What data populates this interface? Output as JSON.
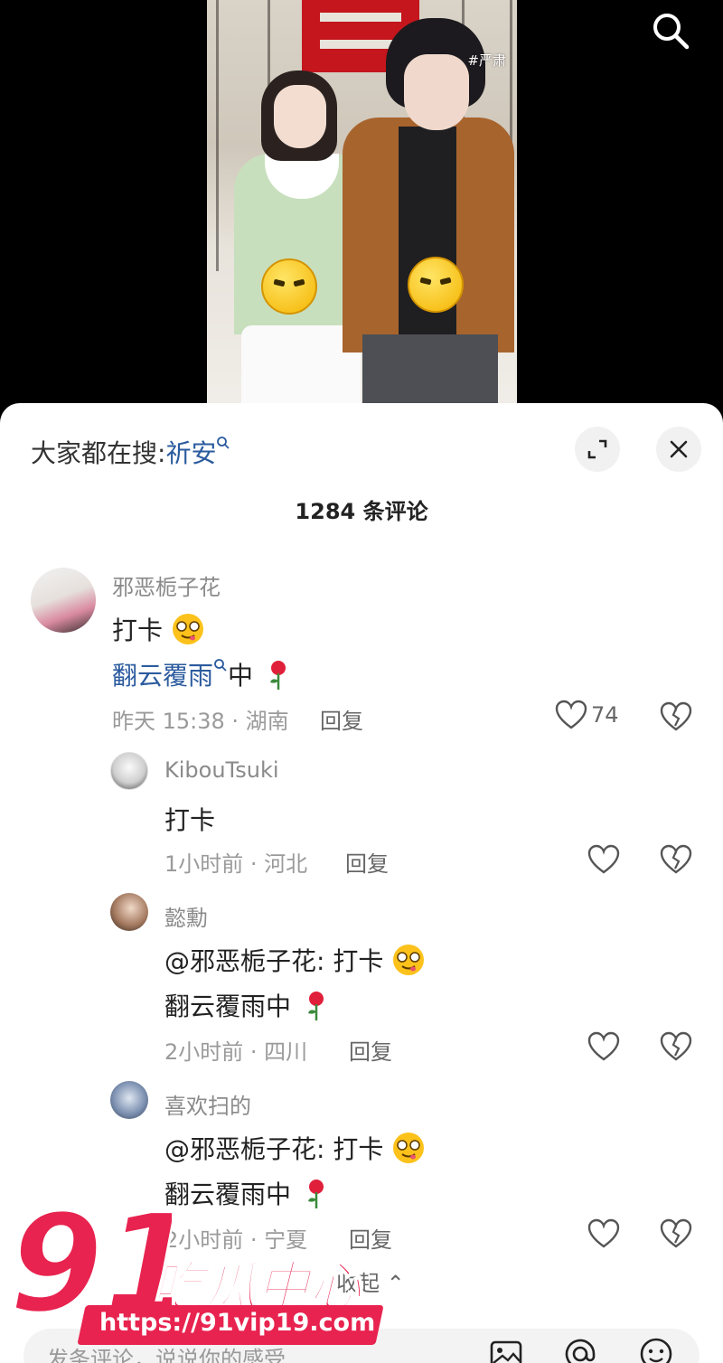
{
  "video": {
    "hashtag": "#严肃"
  },
  "sheet": {
    "search_prefix": "大家都在搜:",
    "search_keyword": "祈安",
    "comment_count": "1284 条评论"
  },
  "comments": [
    {
      "username": "邪恶栀子花",
      "line1": "打卡",
      "line2_link": "翻云覆雨",
      "line2_suffix": "中",
      "time": "昨天 15:38 · 湖南",
      "reply": "回复",
      "likes": "74"
    },
    {
      "username": "KibouTsuki",
      "line1": "打卡",
      "time": "1小时前 · 河北",
      "reply": "回复"
    },
    {
      "username": "懿勳",
      "line1": "@邪恶栀子花: 打卡",
      "line2": "翻云覆雨中",
      "time": "2小时前 · 四川",
      "reply": "回复"
    },
    {
      "username": "喜欢扫的",
      "line1": "@邪恶栀子花: 打卡",
      "line2": "翻云覆雨中",
      "time": "2小时前 · 宁夏",
      "reply": "回复"
    }
  ],
  "collapse_label": "收起",
  "input": {
    "placeholder": "发条评论，说说你的感受"
  },
  "watermark": {
    "number": "91",
    "name": "吃瓜中心",
    "url": "https://91vip19.com"
  },
  "colors": {
    "link": "#2b5b9e",
    "watermark": "#e8234f"
  }
}
